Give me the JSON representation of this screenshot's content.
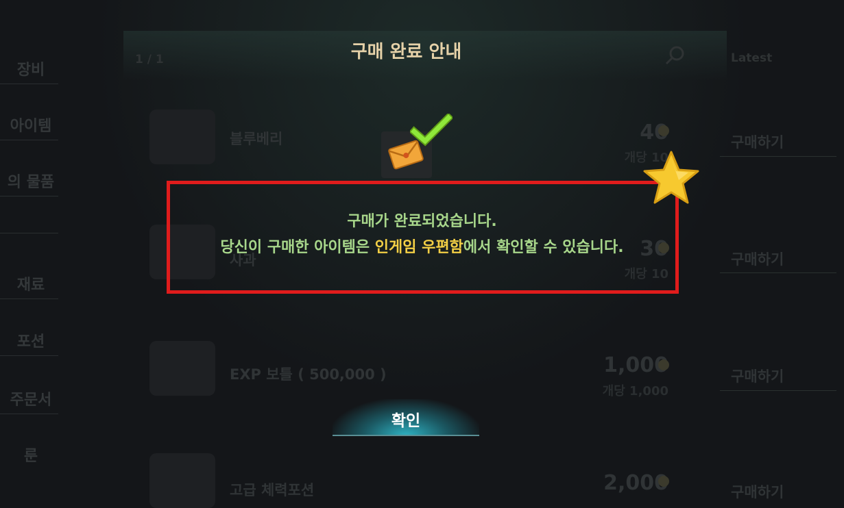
{
  "dialog": {
    "title": "구매 완료 안내",
    "message_line1": "구매가 완료되었습니다.",
    "message_line2_prefix": "당신이 구매한 아이템은 ",
    "message_line2_highlight": "인게임 우편함",
    "message_line2_suffix": "에서 확인할 수 있습니다.",
    "confirm_label": "확인"
  },
  "background": {
    "page_indicator": "1 / 1",
    "sort_label": "Latest",
    "categories": [
      "장비",
      "아이템",
      "의 물품",
      "재료",
      "포션",
      "주문서",
      "룬"
    ],
    "items": [
      {
        "name": "블루베리",
        "price": "40",
        "unit": "개당 10",
        "buy": "구매하기"
      },
      {
        "name": "사과",
        "price": "30",
        "unit": "개당 10",
        "buy": "구매하기"
      },
      {
        "name": "EXP 보틀 ( 500,000 )",
        "price": "1,000",
        "unit": "개당 1,000",
        "buy": "구매하기"
      },
      {
        "name": "고급 체력포션",
        "price": "2,000",
        "unit": "",
        "buy": "구매하기"
      }
    ]
  },
  "colors": {
    "highlight": "#f3cf45",
    "message": "#a8d78b",
    "frame": "#e01c1c"
  }
}
